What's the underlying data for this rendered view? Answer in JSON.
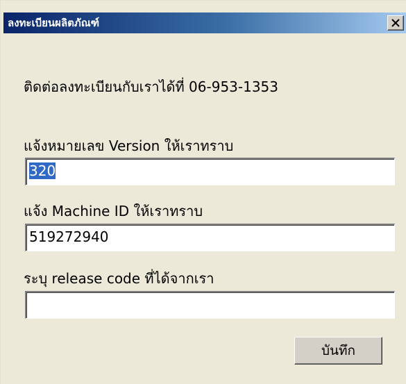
{
  "window": {
    "title": "ลงทะเบียนผลิตภัณฑ์",
    "close_label": "X"
  },
  "contact_text": "ติดต่อลงทะเบียนกับเราได้ที่ 06-953-1353",
  "fields": {
    "version": {
      "label": "แจ้งหมายเลข Version ให้เราทราบ",
      "value": "320"
    },
    "machine_id": {
      "label": "แจ้ง Machine ID ให้เราทราบ",
      "value": "519272940"
    },
    "release_code": {
      "label": "ระบุ release code ที่ได้จากเรา",
      "value": ""
    }
  },
  "save_button_label": "บันทึก",
  "colors": {
    "titlebar_start": "#0a246a",
    "titlebar_end": "#a6caf0",
    "dialog_background": "#ece9d8",
    "selection": "#316ac5"
  }
}
